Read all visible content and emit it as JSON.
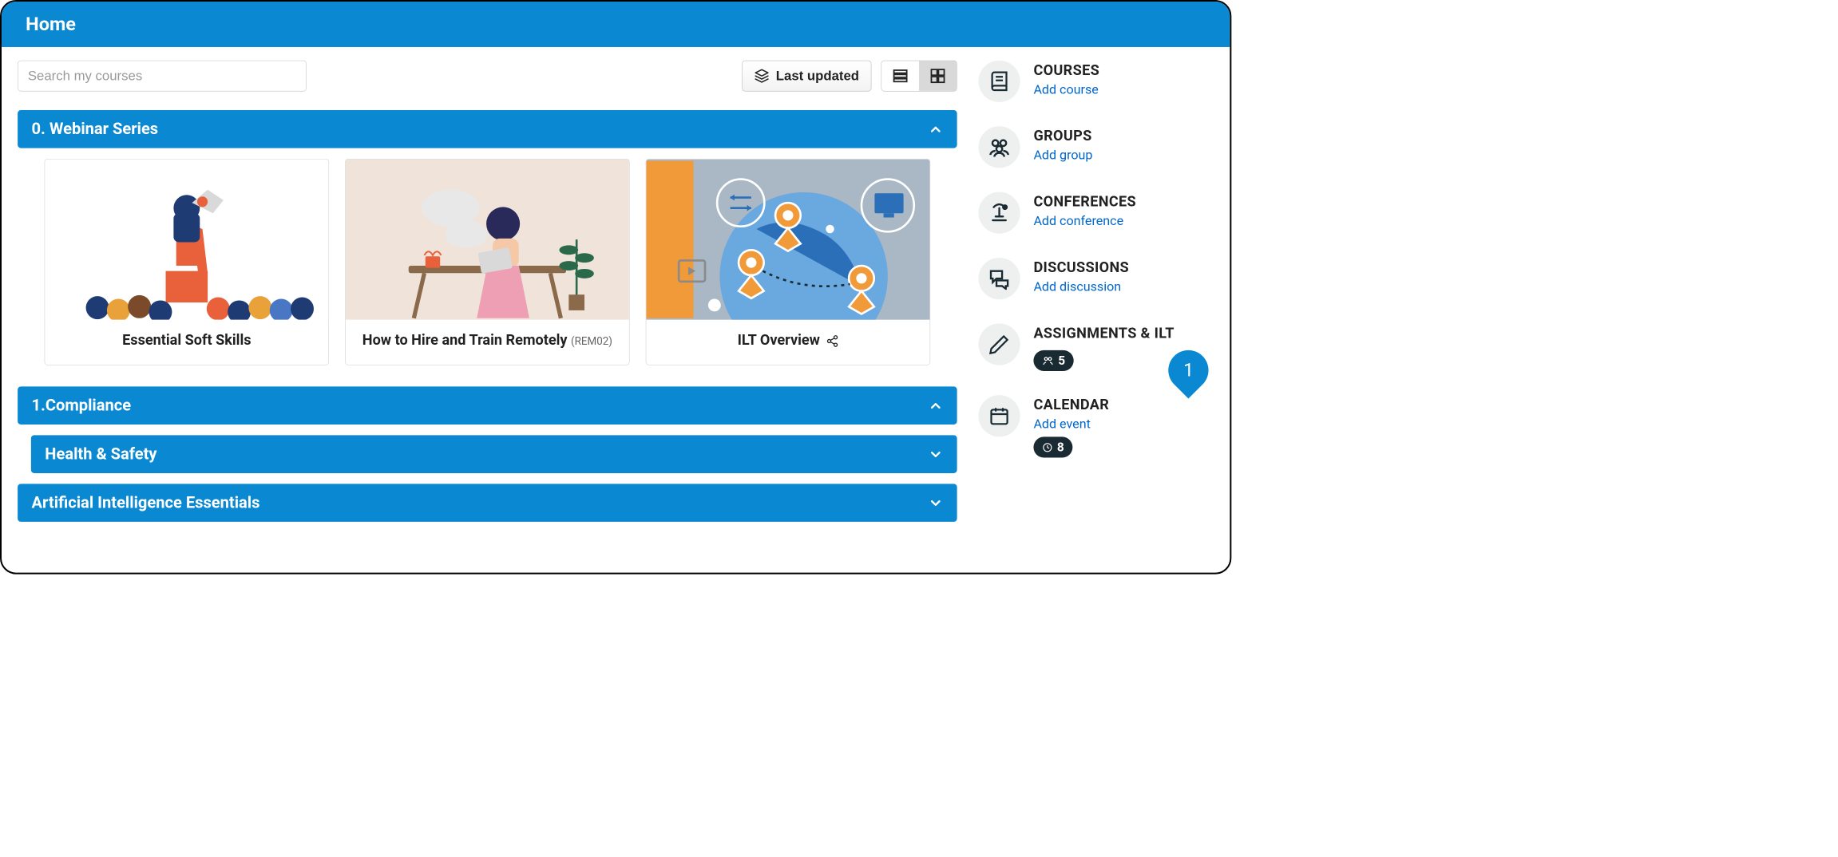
{
  "header": {
    "title": "Home"
  },
  "search": {
    "placeholder": "Search my courses"
  },
  "sort": {
    "label": "Last updated"
  },
  "categories": [
    {
      "title": "0. Webinar Series",
      "expanded": true,
      "courses": [
        {
          "title": "Essential Soft Skills",
          "code": ""
        },
        {
          "title": "How to Hire and Train Remotely",
          "code": "(REM02)"
        },
        {
          "title": "ILT Overview",
          "code": "",
          "share_icon": true
        }
      ]
    },
    {
      "title": "1.Compliance",
      "expanded": true
    },
    {
      "title": "Health & Safety",
      "expanded": false,
      "sub": true
    },
    {
      "title": "Artificial Intelligence Essentials",
      "expanded": false
    }
  ],
  "sidebar": [
    {
      "title": "COURSES",
      "link": "Add course",
      "icon": "book"
    },
    {
      "title": "GROUPS",
      "link": "Add group",
      "icon": "users"
    },
    {
      "title": "CONFERENCES",
      "link": "Add conference",
      "icon": "podium"
    },
    {
      "title": "DISCUSSIONS",
      "link": "Add discussion",
      "icon": "chat"
    },
    {
      "title": "ASSIGNMENTS & ILT",
      "link": "",
      "icon": "pencil",
      "badge_icon": "users",
      "badge_count": "5",
      "callout": "1"
    },
    {
      "title": "CALENDAR",
      "link": "Add event",
      "icon": "calendar",
      "badge_icon": "clock",
      "badge_count": "8"
    }
  ]
}
